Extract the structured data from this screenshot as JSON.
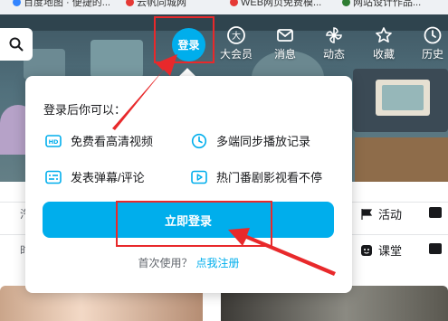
{
  "bookmarks": [
    {
      "label": "百度地图 · 便捷的...",
      "color": "#3385ff"
    },
    {
      "label": "云帆同城网",
      "color": "#e53935"
    },
    {
      "label": "WEB网页免费模...",
      "color": "#e53935"
    },
    {
      "label": "网站设计作品...",
      "color": "#2e7d32"
    }
  ],
  "nav": {
    "login_label": "登录",
    "items": [
      {
        "label": "大会员",
        "icon": "vip-icon"
      },
      {
        "label": "消息",
        "icon": "mail-icon"
      },
      {
        "label": "动态",
        "icon": "pinwheel-icon"
      },
      {
        "label": "收藏",
        "icon": "star-icon"
      },
      {
        "label": "历史",
        "icon": "clock-icon"
      }
    ]
  },
  "popup": {
    "title": "登录后你可以：",
    "features": [
      {
        "label": "免费看高清视频",
        "icon": "hd-icon"
      },
      {
        "label": "多端同步播放记录",
        "icon": "clock-icon"
      },
      {
        "label": "发表弹幕/评论",
        "icon": "danmaku-icon"
      },
      {
        "label": "热门番剧影视看不停",
        "icon": "play-icon"
      }
    ],
    "login_button": "立即登录",
    "first_use": "首次使用？",
    "register_link": "点我注册"
  },
  "page": {
    "right_items": [
      {
        "label": "活动",
        "icon": "flag-icon"
      },
      {
        "label": "课堂",
        "icon": "classroom-icon"
      }
    ],
    "left_chips": [
      "汽",
      "时"
    ]
  },
  "colors": {
    "accent": "#00aeec",
    "annotation": "#e8292b"
  }
}
